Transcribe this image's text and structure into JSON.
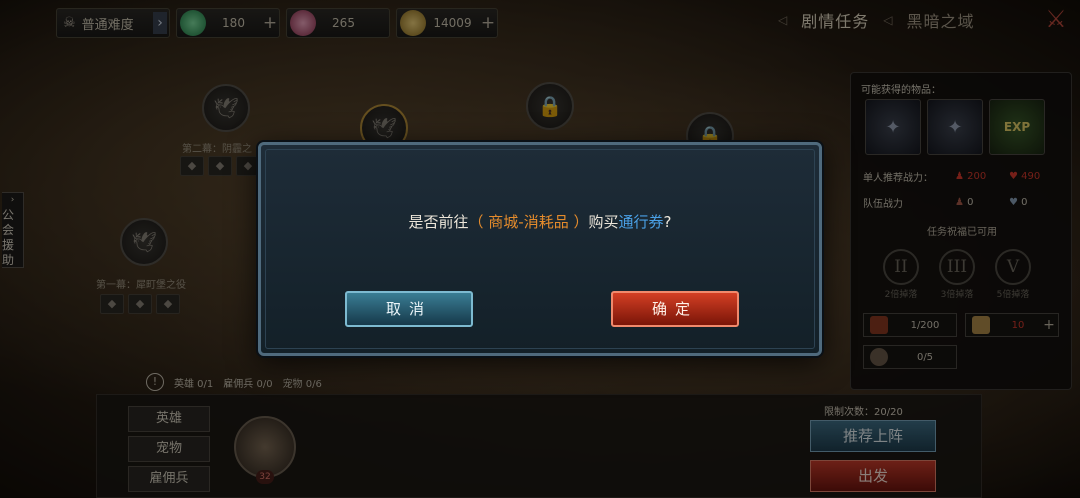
{
  "topbar": {
    "difficulty_label": "普通难度",
    "difficulty_arrow": "›",
    "resources": [
      {
        "icon": "green-gem-icon",
        "value": "180",
        "has_plus": true
      },
      {
        "icon": "pink-crystal-icon",
        "value": "265",
        "has_plus": false
      },
      {
        "icon": "gold-coins-icon",
        "value": "14009",
        "has_plus": true
      }
    ],
    "plus": "+",
    "tabs": [
      {
        "label": "剧情任务",
        "active": true
      },
      {
        "label": "黑暗之域",
        "active": false
      }
    ]
  },
  "side_tab": {
    "label_line1": "公会",
    "label_line2": "援助",
    "arrow": "›"
  },
  "map": {
    "nodes": [
      {
        "label": "第二幕：阴霾之",
        "icon": "bird-icon"
      },
      {
        "label": "",
        "icon": "lock-icon"
      },
      {
        "label": "",
        "icon": "lock-icon"
      },
      {
        "label": "第一幕：犀町堡之役",
        "icon": "bird-icon"
      }
    ]
  },
  "right_panel": {
    "title": "可能获得的物品：",
    "items": [
      "armor-icon",
      "armor-icon",
      "EXP"
    ],
    "single_power_label": "单人推荐战力：",
    "single_power_value1": "200",
    "single_power_value2": "490",
    "team_power_label": "队伍战力",
    "team_power_value1": "0",
    "team_power_value2": "0",
    "blessing_title": "任务祝福已可用",
    "blessings": [
      {
        "numeral": "II",
        "caption": "2倍掉落"
      },
      {
        "numeral": "III",
        "caption": "3倍掉落"
      },
      {
        "numeral": "V",
        "caption": "5倍掉落"
      }
    ],
    "costs": [
      {
        "value": "1/200"
      },
      {
        "value": "10"
      },
      {
        "value": "0/5"
      }
    ]
  },
  "bottom": {
    "warning": "!",
    "hero_count": "英雄 0/1",
    "merc_count": "雇佣兵 0/0",
    "pet_count": "宠物 0/6",
    "side_buttons": [
      "英雄",
      "宠物",
      "雇佣兵"
    ],
    "hero_level": "32",
    "limit_label": "限制次数：20/20",
    "recommend_button": "推荐上阵",
    "go_button": "出发"
  },
  "dialog": {
    "text_prefix": "是否前往",
    "text_highlight": "（ 商城-消耗品 ）",
    "text_middle": "购买",
    "text_item": "通行券",
    "text_suffix": "?",
    "cancel_label": "取消",
    "ok_label": "确定"
  },
  "colors": {
    "dialog_border": "#4f6a7d",
    "highlight_orange": "#e48b2c",
    "highlight_blue": "#4aa0e6",
    "cancel_button": "#3a7d94",
    "ok_button": "#d33f24"
  }
}
